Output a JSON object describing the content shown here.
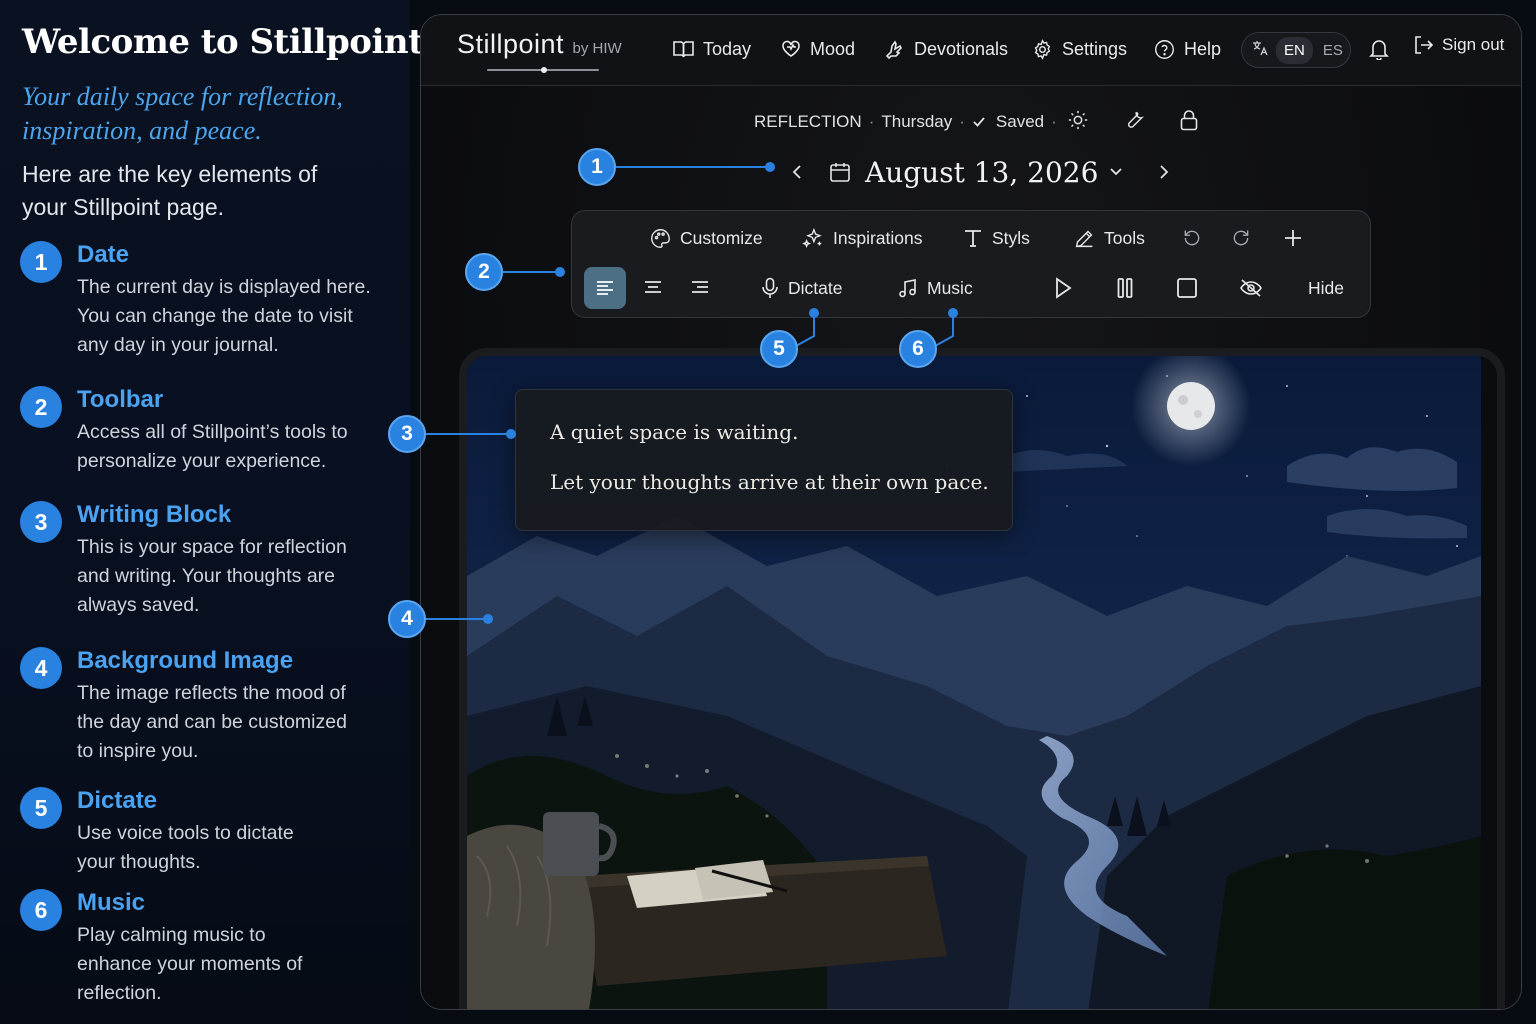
{
  "guide": {
    "title": "Welcome to Stillpoint",
    "subtitle": "Your daily space for reflection, inspiration, and peace.",
    "intro": "Here are the key elements of your Stillpoint page.",
    "items": [
      {
        "num": "1",
        "title": "Date",
        "desc": "The current day is displayed here. You can change the date to visit any day in your journal."
      },
      {
        "num": "2",
        "title": "Toolbar",
        "desc": "Access all of Stillpoint’s tools to personalize your experience."
      },
      {
        "num": "3",
        "title": "Writing Block",
        "desc": "This is your space for reflection and writing. Your thoughts are always saved."
      },
      {
        "num": "4",
        "title": "Background Image",
        "desc": "The image reflects the mood of the day and can be customized to inspire you."
      },
      {
        "num": "5",
        "title": "Dictate",
        "desc": "Use voice tools to dictate your thoughts."
      },
      {
        "num": "6",
        "title": "Music",
        "desc": "Play calming music to enhance your moments of reflection."
      }
    ]
  },
  "app": {
    "brand": "Stillpoint",
    "brand_by": "by HIW",
    "nav": {
      "today": "Today",
      "mood": "Mood",
      "devotionals": "Devotionals",
      "settings": "Settings",
      "help": "Help"
    },
    "lang": {
      "en": "EN",
      "es": "ES"
    },
    "signout": "Sign out",
    "status": {
      "mode": "REFLECTION",
      "day": "Thursday",
      "saved": "Saved"
    },
    "date": "August 13, 2026",
    "toolbar": {
      "customize": "Customize",
      "inspirations": "Inspirations",
      "styls": "Styls",
      "tools": "Tools",
      "dictate": "Dictate",
      "music": "Music",
      "hide": "Hide"
    },
    "writing": {
      "line1": "A quiet space is waiting.",
      "line2": "Let your thoughts arrive at their own pace."
    }
  },
  "callouts": [
    "1",
    "2",
    "3",
    "4",
    "5",
    "6"
  ],
  "colors": {
    "accent": "#2a82e0",
    "heading": "#4aa2f0",
    "background": "#0b0c0f"
  }
}
